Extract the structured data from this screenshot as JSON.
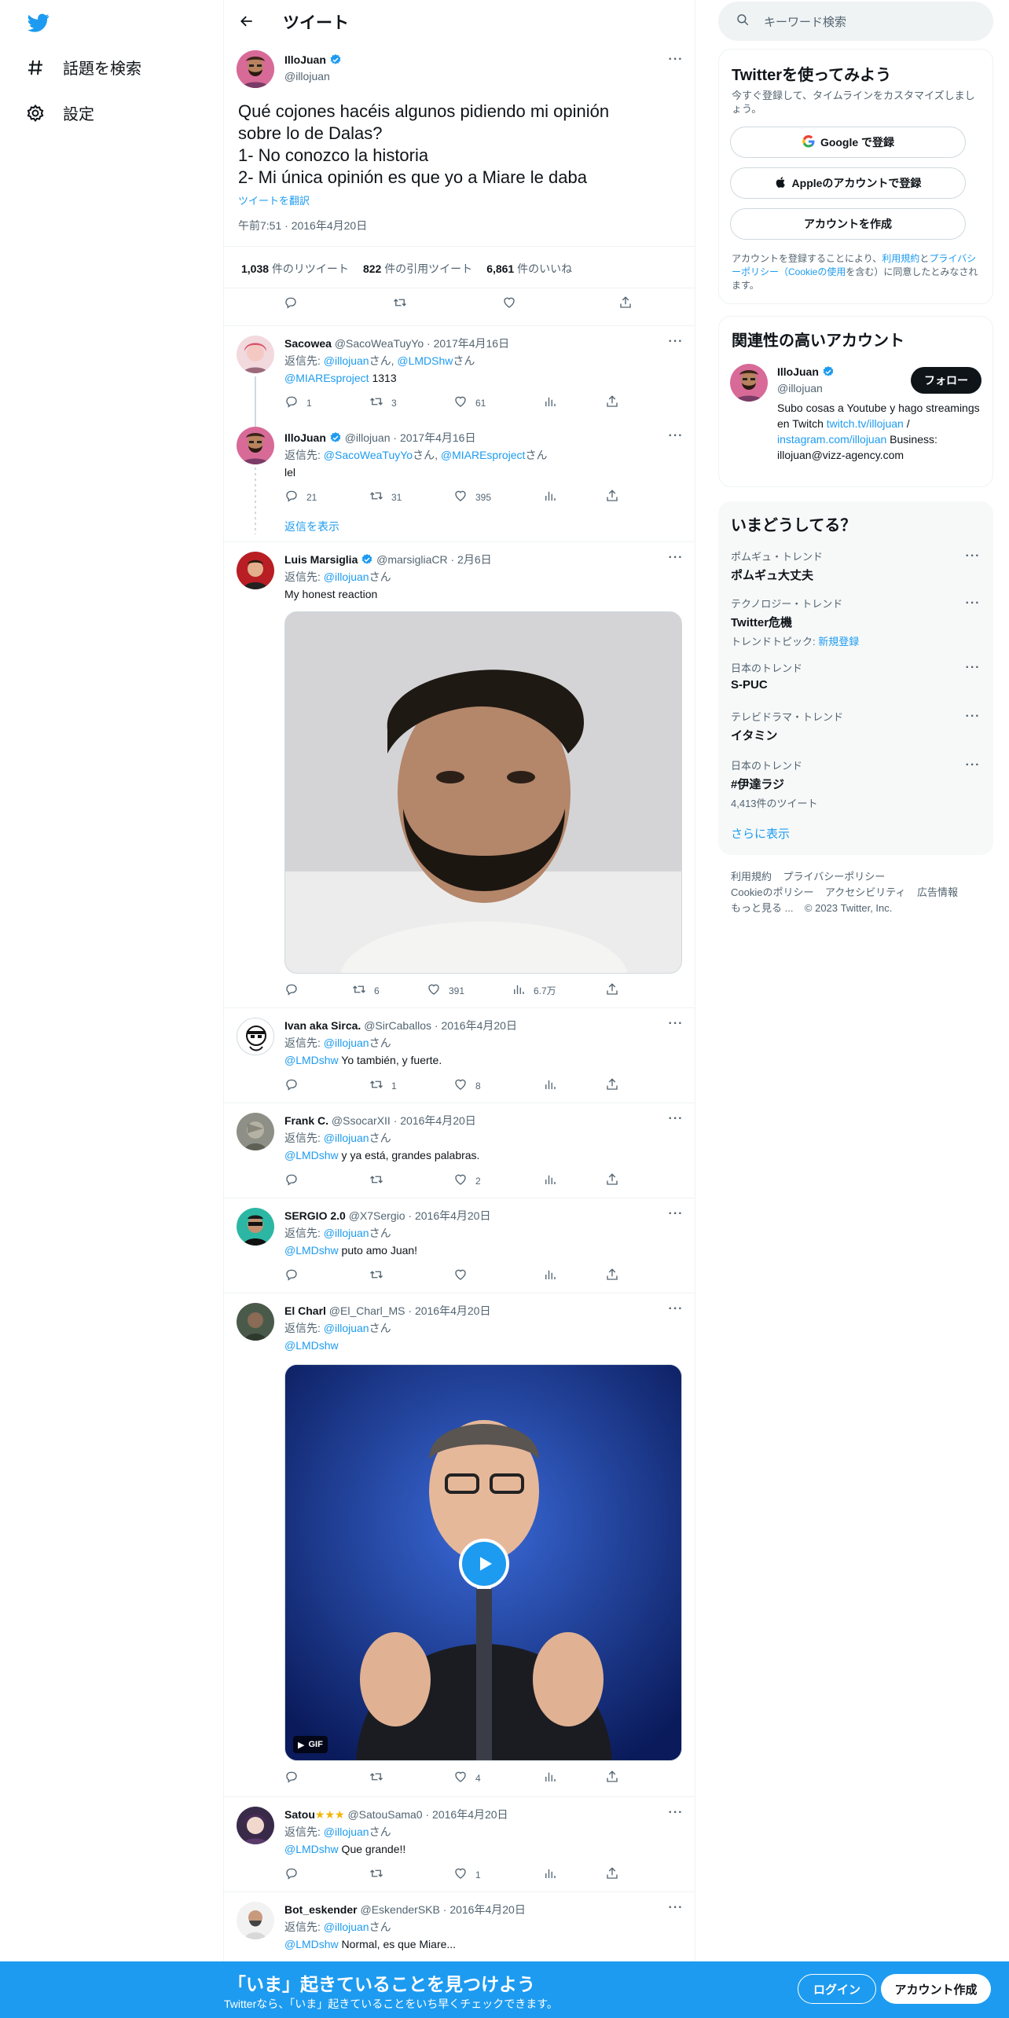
{
  "nav": {
    "explore": "話題を検索",
    "settings": "設定"
  },
  "header": {
    "title": "ツイート"
  },
  "tweet": {
    "name": "IlloJuan",
    "handle": "@illojuan",
    "lines": [
      "Qué cojones hacéis algunos pidiendo mi opinión",
      "sobre lo de Dalas?",
      "1- No conozco la historia",
      "2- Mi única opinión es que yo a Miare le daba"
    ],
    "translate": "ツイートを翻訳",
    "timestamp": "午前7:51 · 2016年4月20日",
    "retweets": "1,038",
    "retweets_label": "件のリツイート",
    "quotes": "822",
    "quotes_label": "件の引用ツイート",
    "likes": "6,861",
    "likes_label": "件のいいね"
  },
  "replies": [
    {
      "name": "Sacowea",
      "handle": "@SacoWeaTuyYo",
      "date": "2017年4月16日",
      "reply_to": [
        "返信先: ",
        "@illojuan",
        "さん, ",
        "@LMDShw",
        "さん"
      ],
      "mention": "@MIAREsproject",
      "text": " 1313",
      "counts": {
        "reply": "1",
        "retweet": "3",
        "like": "61",
        "views": ""
      }
    },
    {
      "name": "IlloJuan",
      "handle": "@illojuan",
      "date": "2017年4月16日",
      "reply_to": [
        "返信先: ",
        "@SacoWeaTuyYo",
        "さん, ",
        "@MIAREsproject",
        "さん"
      ],
      "mention": "",
      "text": "lel",
      "counts": {
        "reply": "21",
        "retweet": "31",
        "like": "395",
        "views": ""
      }
    },
    {
      "name": "Luis Marsiglia",
      "handle": "@marsigliaCR",
      "date": "2月6日",
      "reply_to": [
        "返信先: ",
        "@illojuan",
        "さん",
        "",
        ""
      ],
      "mention": "",
      "text": "My honest reaction",
      "counts": {
        "reply": "",
        "retweet": "6",
        "like": "391",
        "views": "6.7万"
      }
    },
    {
      "name": "Ivan aka Sirca.",
      "handle": "@SirCaballos",
      "date": "2016年4月20日",
      "reply_to": [
        "返信先: ",
        "@illojuan",
        "さん",
        "",
        ""
      ],
      "mention": "@LMDshw",
      "text": " Yo también, y fuerte.",
      "counts": {
        "reply": "",
        "retweet": "1",
        "like": "8",
        "views": ""
      }
    },
    {
      "name": "Frank C.",
      "handle": "@SsocarXII",
      "date": "2016年4月20日",
      "reply_to": [
        "返信先: ",
        "@illojuan",
        "さん",
        "",
        ""
      ],
      "mention": "@LMDshw",
      "text": " y ya está, grandes palabras.",
      "counts": {
        "reply": "",
        "retweet": "",
        "like": "2",
        "views": ""
      }
    },
    {
      "name": "SERGIO 2.0",
      "handle": "@X7Sergio",
      "date": "2016年4月20日",
      "reply_to": [
        "返信先: ",
        "@illojuan",
        "さん",
        "",
        ""
      ],
      "mention": "@LMDshw",
      "text": " puto amo Juan!",
      "counts": {
        "reply": "",
        "retweet": "",
        "like": "",
        "views": ""
      }
    },
    {
      "name": "El Charl",
      "handle": "@El_Charl_MS",
      "date": "2016年4月20日",
      "reply_to": [
        "返信先: ",
        "@illojuan",
        "さん",
        "",
        ""
      ],
      "mention": "@LMDshw",
      "text": "",
      "counts": {
        "reply": "",
        "retweet": "",
        "like": "4",
        "views": ""
      }
    },
    {
      "name": "Satou",
      "stars": "★★★",
      "handle": "@SatouSama0",
      "date": "2016年4月20日",
      "reply_to": [
        "返信先: ",
        "@illojuan",
        "さん",
        "",
        ""
      ],
      "mention": "@LMDshw",
      "text": " Que grande!!",
      "counts": {
        "reply": "",
        "retweet": "",
        "like": "1",
        "views": ""
      }
    },
    {
      "name": "Bot_eskender",
      "handle": "@EskenderSKB",
      "date": "2016年4月20日",
      "reply_to": [
        "返信先: ",
        "@illojuan",
        "さん",
        "",
        ""
      ],
      "mention": "@LMDshw",
      "text": " Normal, es que Miare...",
      "counts": {
        "reply": "",
        "retweet": "",
        "like": "",
        "views": ""
      }
    }
  ],
  "show_replies": "返信を表示",
  "gif_badge": "GIF",
  "sidebar": {
    "search_placeholder": "キーワード検索",
    "join": {
      "title": "Twitterを使ってみよう",
      "desc": "今すぐ登録して、タイムラインをカスタマイズしましょう。",
      "google": "Google で登録",
      "apple": "Appleのアカウントで登録",
      "create": "アカウントを作成",
      "terms_a": "アカウントを登録することにより、",
      "terms_link1": "利用規約",
      "terms_b": "と",
      "terms_link2": "プライバシーポリシー（Cookieの使用",
      "terms_c": "を含む）に同意したとみなされます。"
    },
    "related": {
      "title": "関連性の高いアカウント",
      "name": "IlloJuan",
      "handle": "@illojuan",
      "follow": "フォロー",
      "bio_a": "Subo cosas a Youtube y hago streamings en Twitch ",
      "bio_link1": "twitch.tv/illojuan",
      "bio_b": " / ",
      "bio_link2": "instagram.com/illojuan",
      "bio_c": " Business: illojuan@vizz-agency.com"
    },
    "trends": {
      "title": "いまどうしてる？",
      "items": [
        {
          "cat": "ポムギュ・トレンド",
          "title": "ポムギュ大丈夫",
          "sub": "",
          "sub_link": ""
        },
        {
          "cat": "テクノロジー・トレンド",
          "title": "Twitter危機",
          "sub": "トレンドトピック: ",
          "sub_link": "新規登録"
        },
        {
          "cat": "日本のトレンド",
          "title": "S-PUC",
          "sub": "",
          "sub_link": ""
        },
        {
          "cat": "テレビドラマ・トレンド",
          "title": "イタミン",
          "sub": "",
          "sub_link": ""
        },
        {
          "cat": "日本のトレンド",
          "title": "#伊達ラジ",
          "sub": "4,413件のツイート",
          "sub_link": ""
        }
      ],
      "more": "さらに表示"
    },
    "footer": {
      "l1": "利用規約",
      "l2": "プライバシーポリシー",
      "l3": "Cookieのポリシー",
      "l4": "アクセシビリティ",
      "l5": "広告情報",
      "l6": "もっと見る ...",
      "l7": "© 2023 Twitter, Inc."
    }
  },
  "bottombar": {
    "title": "「いま」起きていることを見つけよう",
    "sub": "Twitterなら、「いま」起きていることをいち早くチェックできます。",
    "login": "ログイン",
    "signup": "アカウント作成"
  },
  "colors": {
    "accent": "#1d9bf0",
    "text": "#0f1419",
    "muted": "#536471"
  }
}
